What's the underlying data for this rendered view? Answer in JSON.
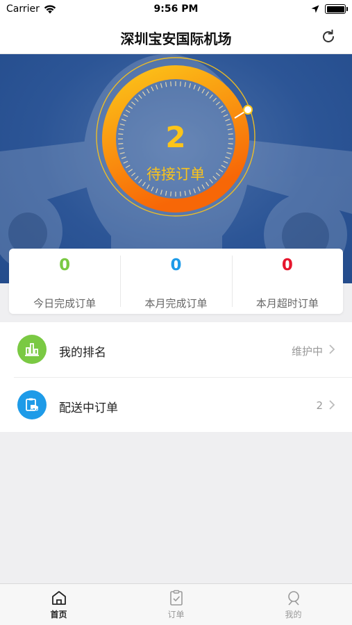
{
  "status_bar": {
    "carrier": "Carrier",
    "time": "9:56 PM"
  },
  "nav": {
    "title": "深圳宝安国际机场",
    "refresh_icon": "refresh-icon"
  },
  "hero": {
    "pending_count": "2",
    "pending_label": "待接订单",
    "gauge_color_start": "#fcc419",
    "gauge_color_end": "#f76707"
  },
  "stats": [
    {
      "value": "0",
      "label": "今日完成订单",
      "color": "#7ac943"
    },
    {
      "value": "0",
      "label": "本月完成订单",
      "color": "#1e9be8"
    },
    {
      "value": "0",
      "label": "本月超时订单",
      "color": "#e6162d"
    }
  ],
  "menu": [
    {
      "label": "我的排名",
      "value": "维护中",
      "icon": "bar-chart-icon",
      "icon_color": "#7ac943"
    },
    {
      "label": "配送中订单",
      "value": "2",
      "icon": "delivery-icon",
      "icon_color": "#1e9be8"
    }
  ],
  "tabs": [
    {
      "label": "首页",
      "icon": "home-icon",
      "active": true
    },
    {
      "label": "订单",
      "icon": "clipboard-check-icon",
      "active": false
    },
    {
      "label": "我的",
      "icon": "user-icon",
      "active": false
    }
  ]
}
